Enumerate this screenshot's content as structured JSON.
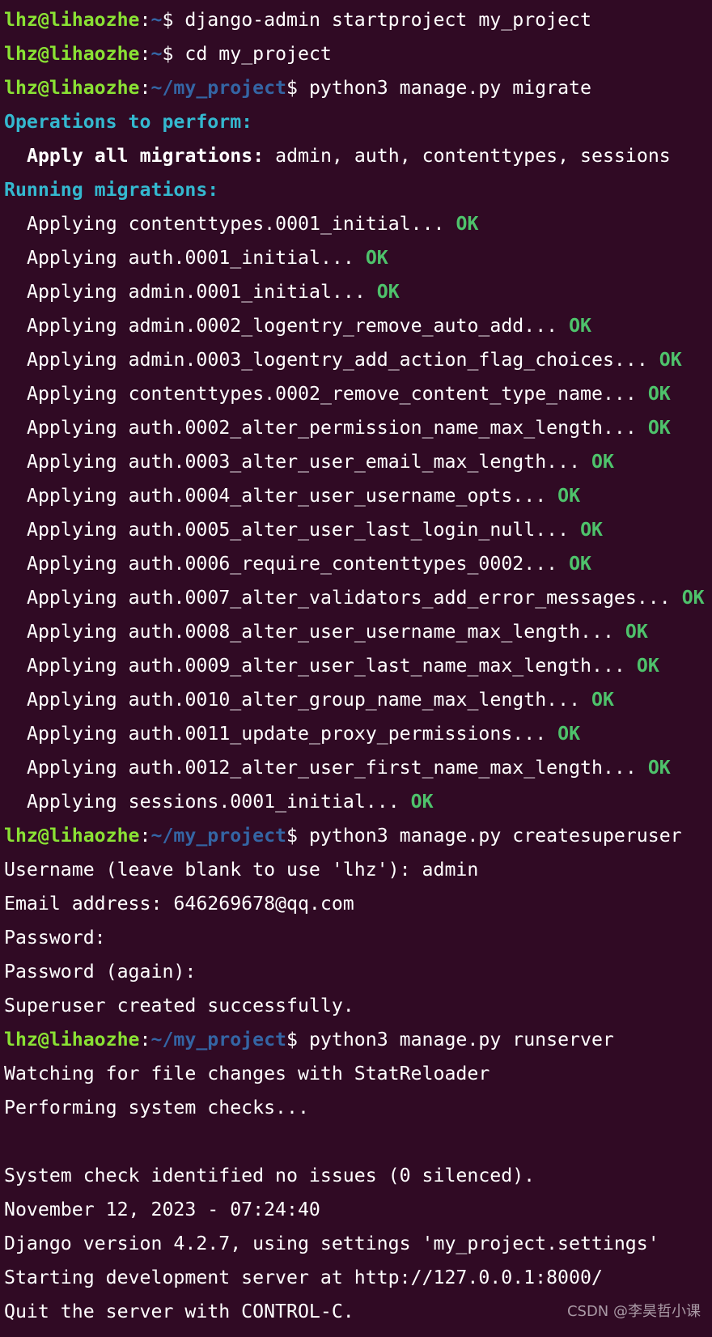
{
  "colors": {
    "background": "#300a24",
    "prompt_user": "#8ae234",
    "prompt_path": "#3465a4",
    "heading": "#34b8cf",
    "ok": "#4ec26b",
    "text": "#ffffff"
  },
  "prompt": {
    "user_host": "lhz@lihaozhe",
    "separator": ":",
    "home_path": "~",
    "project_path": "~/my_project",
    "dollar": "$ "
  },
  "commands": {
    "cmd1": "django-admin startproject my_project",
    "cmd2": "cd my_project",
    "cmd3": "python3 manage.py migrate",
    "cmd4": "python3 manage.py createsuperuser",
    "cmd5": "python3 manage.py runserver"
  },
  "migrate": {
    "operations_heading": "Operations to perform:",
    "apply_all_label": "Apply all migrations:",
    "apply_all_value": " admin, auth, contenttypes, sessions",
    "running_heading": "Running migrations:",
    "ok_label": "OK",
    "migrations": [
      "Applying contenttypes.0001_initial...",
      "Applying auth.0001_initial...",
      "Applying admin.0001_initial...",
      "Applying admin.0002_logentry_remove_auto_add...",
      "Applying admin.0003_logentry_add_action_flag_choices...",
      "Applying contenttypes.0002_remove_content_type_name...",
      "Applying auth.0002_alter_permission_name_max_length...",
      "Applying auth.0003_alter_user_email_max_length...",
      "Applying auth.0004_alter_user_username_opts...",
      "Applying auth.0005_alter_user_last_login_null...",
      "Applying auth.0006_require_contenttypes_0002...",
      "Applying auth.0007_alter_validators_add_error_messages...",
      "Applying auth.0008_alter_user_username_max_length...",
      "Applying auth.0009_alter_user_last_name_max_length...",
      "Applying auth.0010_alter_group_name_max_length...",
      "Applying auth.0011_update_proxy_permissions...",
      "Applying auth.0012_alter_user_first_name_max_length...",
      "Applying sessions.0001_initial..."
    ]
  },
  "createsuperuser": {
    "username_line": "Username (leave blank to use 'lhz'): admin",
    "email_line": "Email address: 646269678@qq.com",
    "password_line": "Password:",
    "password_again_line": "Password (again):",
    "success_line": "Superuser created successfully."
  },
  "runserver": {
    "watching_line": "Watching for file changes with StatReloader",
    "checks_line": "Performing system checks...",
    "blank_line": "",
    "check_result_line": "System check identified no issues (0 silenced).",
    "datetime_line": "November 12, 2023 - 07:24:40",
    "version_line": "Django version 4.2.7, using settings 'my_project.settings'",
    "starting_line": "Starting development server at http://127.0.0.1:8000/",
    "quit_line": "Quit the server with CONTROL-C."
  },
  "watermark": "CSDN @李昊哲小课"
}
